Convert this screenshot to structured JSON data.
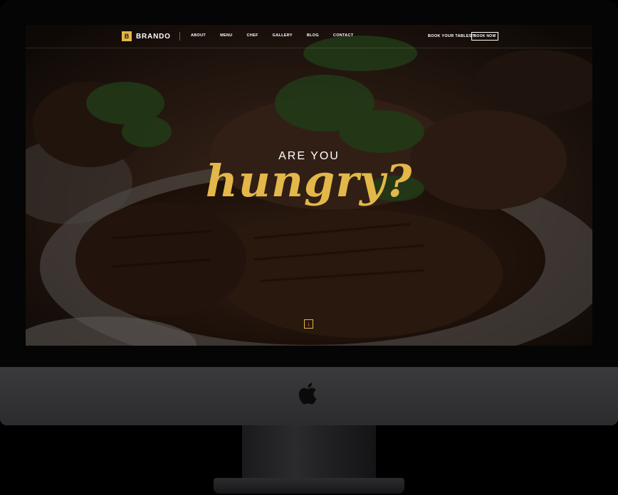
{
  "brand": {
    "logo_letter": "B",
    "name": "BRANDO"
  },
  "nav": {
    "items": [
      "ABOUT",
      "MENU",
      "CHEF",
      "GALLERY",
      "BLOG",
      "CONTACT"
    ],
    "book_label": "BOOK YOUR TABLES?",
    "book_button": "BOOK NOW"
  },
  "hero": {
    "subtitle": "ARE YOU",
    "title": "hungry?",
    "scroll_icon": "arrow-down-icon"
  },
  "colors": {
    "accent": "#e3b749",
    "overlay": "#000000",
    "frame": "#1a1a1c"
  }
}
